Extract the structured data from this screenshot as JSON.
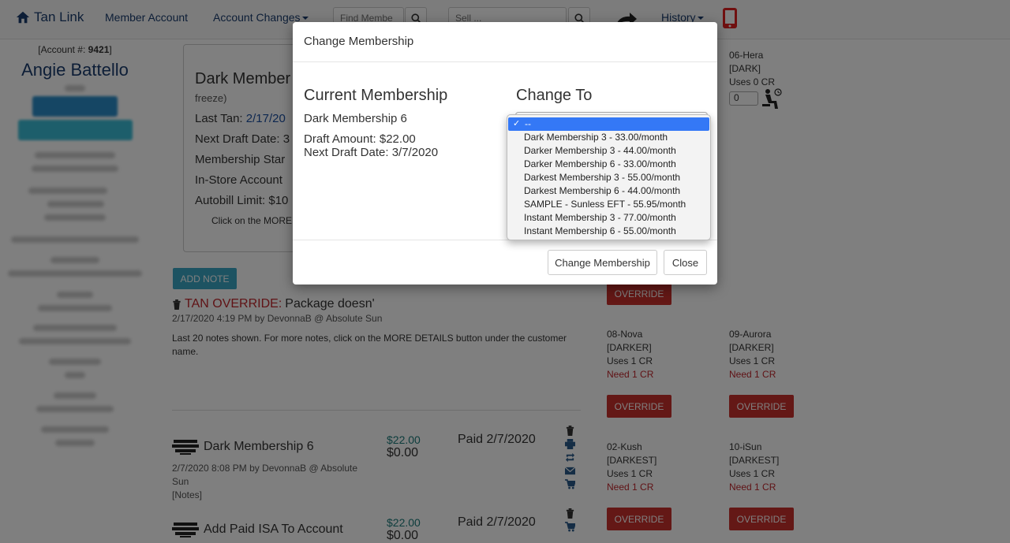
{
  "nav": {
    "brand": "Tan Link",
    "member_account": "Member Account",
    "account_changes": "Account Changes",
    "find_member_placeholder": "Find Membe",
    "sell_placeholder": "Sell ...",
    "history": "History"
  },
  "customer": {
    "account_no_label": "[Account #:",
    "account_no": "9421",
    "account_no_close": "]",
    "name": "Angie Battello"
  },
  "package": {
    "title": "Dark Member",
    "freeze": "freeze)",
    "last_tan_label": "Last Tan:",
    "last_tan_date": "2/17/20",
    "next_draft": "Next Draft Date: 3",
    "membership_start": "Membership Star",
    "in_store_account": "In-Store Account",
    "autobill_limit": "Autobill Limit: $10",
    "more_hint": "Click on the MORE"
  },
  "notes": {
    "add_note": "ADD NOTE",
    "note_title_prefix": "TAN OVERRIDE:",
    "note_title_text": "Package doesn'",
    "note_meta": "2/17/2020 4:19 PM by DevonnaB @ Absolute Sun",
    "note_info": "Last 20 notes shown. For more notes, click on the MORE DETAILS button under the customer name."
  },
  "transactions": [
    {
      "name": "Dark Membership 6",
      "amount": "$22.00",
      "balance": "$0.00",
      "paid": "Paid 2/7/2020",
      "meta_line1": "2/7/2020 8:08 PM by DevonnaB @ Absolute",
      "meta_line2": "Sun",
      "meta_line3": "[Notes]"
    },
    {
      "name": "Add Paid ISA To Account",
      "amount": "$22.00",
      "balance": "$0.00",
      "paid": "Paid 2/7/2020"
    }
  ],
  "beds": {
    "hera": {
      "name": "06-Hera",
      "level": "[DARK]",
      "uses": "Uses 0 CR",
      "qty": "0"
    },
    "nova": {
      "name": "08-Nova",
      "level": "[DARKER]",
      "uses": "Uses 1 CR",
      "need": "Need 1 CR"
    },
    "aurora": {
      "name": "09-Aurora",
      "level": "[DARKER]",
      "uses": "Uses 1 CR",
      "need": "Need 1 CR"
    },
    "kush": {
      "name": "02-Kush",
      "level": "[DARKEST]",
      "uses": "Uses 1 CR",
      "need": "Need 1 CR"
    },
    "isun": {
      "name": "10-iSun",
      "level": "[DARKEST]",
      "uses": "Uses 1 CR",
      "need": "Need 1 CR"
    },
    "override_label": "OVERRIDE"
  },
  "modal": {
    "title": "Change Membership",
    "current_heading": "Current Membership",
    "change_to_heading": "Change To",
    "current_name": "Dark Membership 6",
    "draft_amount": "Draft Amount: $22.00",
    "next_draft": "Next Draft Date: 3/7/2020",
    "change_button": "Change Membership",
    "close_button": "Close",
    "options": [
      "--",
      "Dark Membership 3 - 33.00/month",
      "Darker Membership 3 - 44.00/month",
      "Darker Membership 6 - 33.00/month",
      "Darkest Membership 3 - 55.00/month",
      "Darkest Membership 6 - 44.00/month",
      "SAMPLE - Sunless EFT - 55.95/month",
      "Instant Membership 3 - 77.00/month",
      "Instant Membership 6 - 55.00/month"
    ],
    "selected_index": 0
  },
  "colors": {
    "brand": "#1a3c6e",
    "override": "#c9302c",
    "add_note": "#3ba7c4",
    "dropdown_highlight": "#3478f6"
  }
}
